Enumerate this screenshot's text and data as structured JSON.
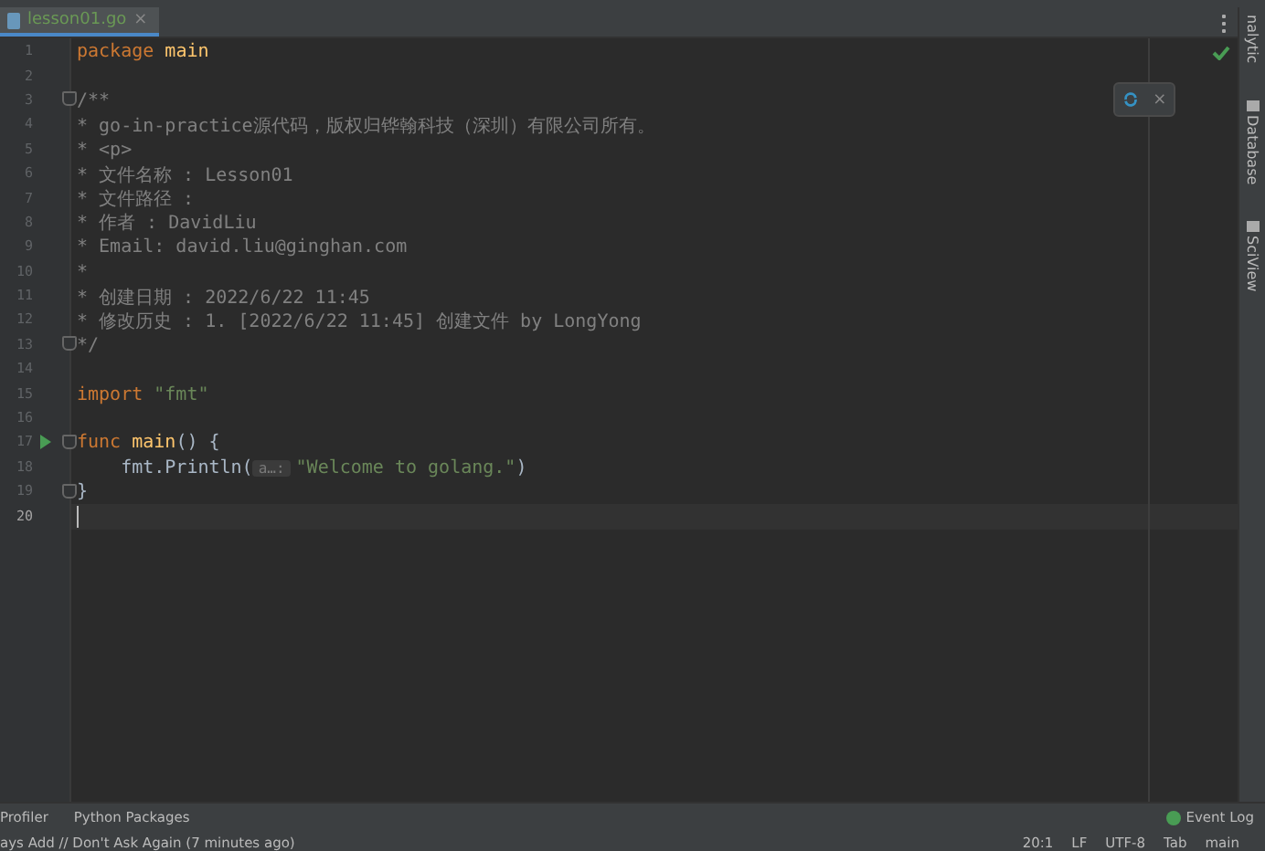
{
  "tabs": [
    {
      "label": "lesson01.go",
      "close": "×",
      "selected": true
    }
  ],
  "side_tools": [
    {
      "label": "nalytic",
      "icon": false
    },
    {
      "label": "Database",
      "icon": true
    },
    {
      "label": "SciView",
      "icon": true
    }
  ],
  "popup": {
    "close": "×"
  },
  "editor": {
    "lines": [
      {
        "number": "1",
        "fold": false,
        "run": false,
        "current": false,
        "tokens": [
          {
            "kind": "keyword",
            "text": "package"
          },
          {
            "kind": "func",
            "text": "main",
            "space_before": true
          }
        ]
      },
      {
        "number": "2",
        "fold": false,
        "run": false,
        "current": false
      },
      {
        "number": "3",
        "fold": true,
        "run": false,
        "current": false,
        "tokens": [
          {
            "kind": "comment",
            "text": "/**"
          }
        ]
      },
      {
        "number": "4",
        "fold": false,
        "run": false,
        "current": false,
        "tokens": [
          {
            "kind": "comment",
            "text": "* go-in-practice源代码，版权归铧翰科技（深圳）有限公司所有。"
          }
        ]
      },
      {
        "number": "5",
        "fold": false,
        "run": false,
        "current": false,
        "tokens": [
          {
            "kind": "comment",
            "text": "* <p>"
          }
        ]
      },
      {
        "number": "6",
        "fold": false,
        "run": false,
        "current": false,
        "tokens": [
          {
            "kind": "comment",
            "text": "* 文件名称 : Lesson01"
          }
        ]
      },
      {
        "number": "7",
        "fold": false,
        "run": false,
        "current": false,
        "tokens": [
          {
            "kind": "comment",
            "text": "* 文件路径 :"
          }
        ]
      },
      {
        "number": "8",
        "fold": false,
        "run": false,
        "current": false,
        "tokens": [
          {
            "kind": "comment",
            "text": "* 作者 : DavidLiu"
          }
        ]
      },
      {
        "number": "9",
        "fold": false,
        "run": false,
        "current": false,
        "tokens": [
          {
            "kind": "comment",
            "text": "* Email: david.liu@ginghan.com"
          }
        ]
      },
      {
        "number": "10",
        "fold": false,
        "run": false,
        "current": false,
        "tokens": [
          {
            "kind": "comment",
            "text": "*"
          }
        ]
      },
      {
        "number": "11",
        "fold": false,
        "run": false,
        "current": false,
        "tokens": [
          {
            "kind": "comment",
            "text": "* 创建日期 : 2022/6/22 11:45"
          }
        ]
      },
      {
        "number": "12",
        "fold": false,
        "run": false,
        "current": false,
        "tokens": [
          {
            "kind": "comment",
            "text": "* 修改历史 : 1. [2022/6/22 11:45] 创建文件 by LongYong"
          }
        ]
      },
      {
        "number": "13",
        "fold": true,
        "run": false,
        "current": false,
        "tokens": [
          {
            "kind": "comment",
            "text": "*/"
          }
        ]
      },
      {
        "number": "14",
        "fold": false,
        "run": false,
        "current": false
      },
      {
        "number": "15",
        "fold": false,
        "run": false,
        "current": false,
        "tokens": [
          {
            "kind": "keyword",
            "text": "import"
          },
          {
            "kind": "string",
            "text": "\"fmt\"",
            "space_before": true
          }
        ]
      },
      {
        "number": "16",
        "fold": false,
        "run": false,
        "current": false
      },
      {
        "number": "17",
        "fold": true,
        "run": true,
        "current": false,
        "tokens": [
          {
            "kind": "keyword",
            "text": "func"
          },
          {
            "kind": "func",
            "text": "main",
            "space_before": true
          },
          {
            "kind": "plain",
            "text": "() {"
          }
        ]
      },
      {
        "number": "18",
        "fold": false,
        "run": false,
        "current": false,
        "tokens": [
          {
            "kind": "ident",
            "text": "fmt.Println(",
            "indented": true
          },
          {
            "kind": "hint",
            "text": "a…:"
          },
          {
            "kind": "string",
            "text": "\"Welcome to golang.\""
          },
          {
            "kind": "plain",
            "text": ")"
          }
        ]
      },
      {
        "number": "19",
        "fold": true,
        "run": false,
        "current": false,
        "tokens": [
          {
            "kind": "plain",
            "text": "}"
          }
        ]
      },
      {
        "number": "20",
        "fold": false,
        "run": false,
        "current": true
      }
    ]
  },
  "tool_bar": {
    "left": [
      {
        "label": "Profiler"
      },
      {
        "label": "Python Packages"
      }
    ],
    "right": {
      "label": "Event Log"
    }
  },
  "status_bar": {
    "message": "ays Add // Don't Ask Again (7 minutes ago)",
    "items": [
      "20:1",
      "LF",
      "UTF-8",
      "Tab",
      "main"
    ]
  }
}
